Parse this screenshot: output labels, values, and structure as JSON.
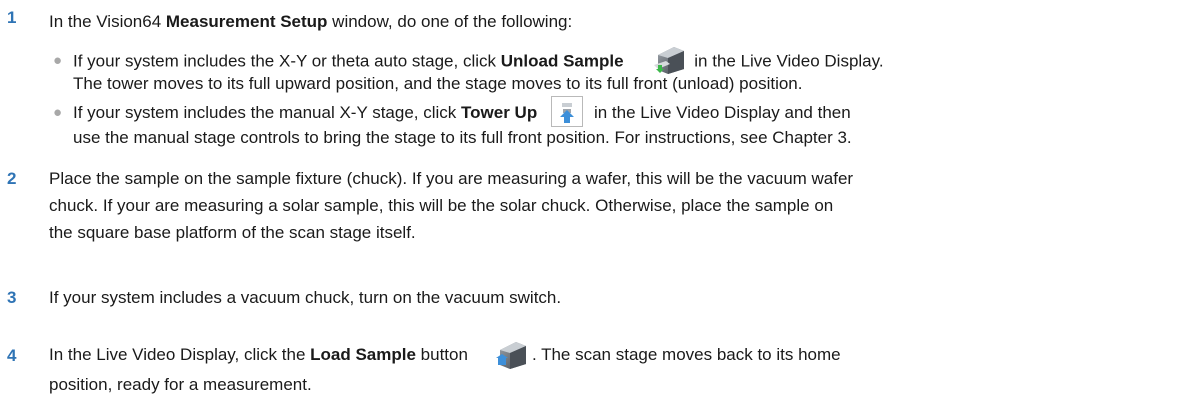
{
  "step1": {
    "number": "1",
    "text_a": "In the Vision64 ",
    "text_b": "Measurement Setup",
    "text_c": " window, do one of the following:"
  },
  "bullet1": {
    "line1_a": "If your system includes the X-Y or theta auto stage, click ",
    "line1_b": "Unload Sample",
    "line1_c": " in the Live Video Display.",
    "line2": "The tower moves to its full upward position, and the stage moves to its full front (unload) position.",
    "icon": "unload-sample-icon"
  },
  "bullet2": {
    "line1_a": "If your system includes the manual X-Y stage, click ",
    "line1_b": "Tower Up",
    "line1_c": " in the Live Video Display and then",
    "line2": "use the manual stage controls to bring the stage to its full front position. For instructions, see Chapter 3.",
    "icon": "tower-up-icon"
  },
  "step2": {
    "number": "2",
    "line1": "Place the sample on the sample fixture (chuck). If you are measuring a wafer, this will be the vacuum wafer",
    "line2": "chuck. If your are measuring a solar sample, this will be the solar chuck. Otherwise, place the sample on",
    "line3": "the square base platform of the scan stage itself."
  },
  "step3": {
    "number": "3",
    "text": "If your system includes a vacuum chuck, turn on the vacuum switch."
  },
  "step4": {
    "number": "4",
    "line1_a": "In the Live Video Display, click the ",
    "line1_b": "Load Sample",
    "line1_c": " button",
    "line1_d": ". The scan stage moves back to its home",
    "line2": "position, ready for a measurement.",
    "icon": "load-sample-icon"
  },
  "colors": {
    "step_number": "#2f74b5",
    "bullet": "#a8a8a8",
    "text": "#1a1a1a"
  }
}
